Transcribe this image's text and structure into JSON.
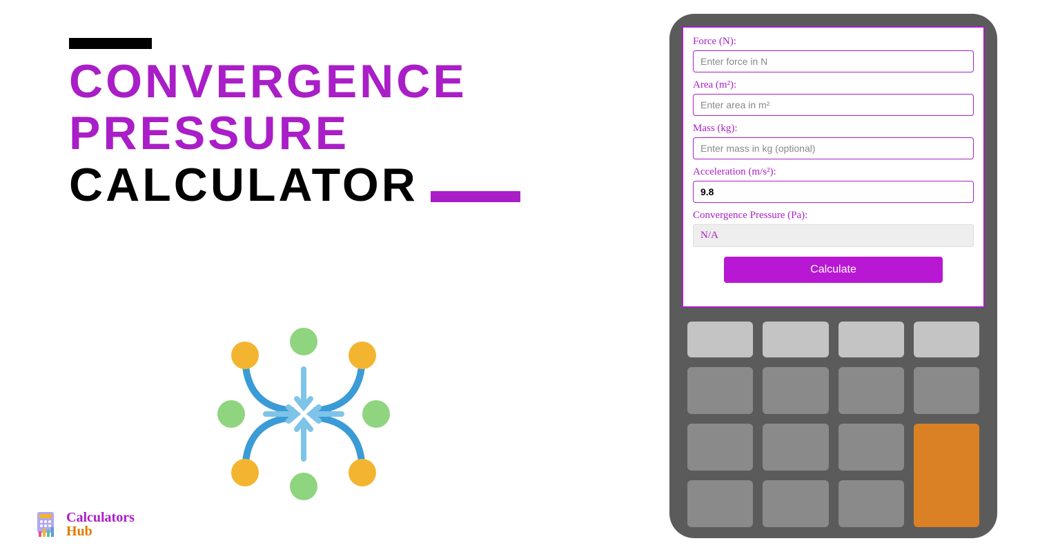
{
  "title": {
    "line1": "CONVERGENCE",
    "line2": "PRESSURE",
    "line3": "CALCULATOR"
  },
  "logo": {
    "top": "Calculators",
    "bottom": "Hub"
  },
  "form": {
    "force_label": "Force (N):",
    "force_placeholder": "Enter force in N",
    "area_label": "Area (m²):",
    "area_placeholder": "Enter area in m²",
    "mass_label": "Mass (kg):",
    "mass_placeholder": "Enter mass in kg (optional)",
    "accel_label": "Acceleration (m/s²):",
    "accel_value": "9.8",
    "result_label": "Convergence Pressure (Pa):",
    "result_value": "N/A",
    "button": "Calculate"
  },
  "colors": {
    "purple": "#a91ec7",
    "orange": "#d98124"
  }
}
